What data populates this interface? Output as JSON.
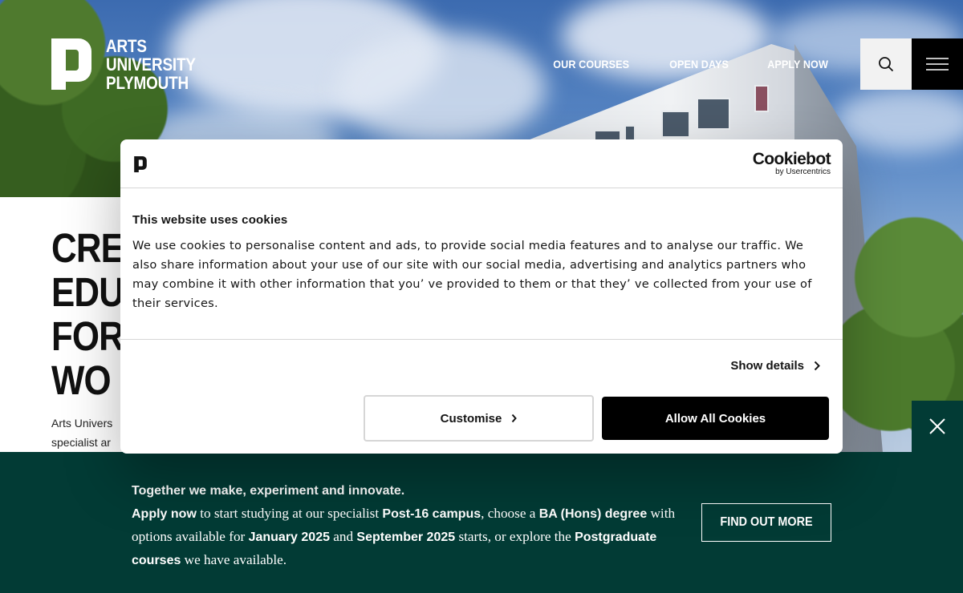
{
  "header": {
    "logo_lines": [
      "ARTS",
      "UNIVERSITY",
      "PLYMOUTH"
    ],
    "nav": [
      {
        "label": "OUR COURSES"
      },
      {
        "label": "OPEN DAYS"
      },
      {
        "label": "APPLY NOW"
      }
    ],
    "search_icon": "search-icon",
    "menu_icon": "hamburger-menu-icon"
  },
  "hero": {
    "title_lines": [
      "CRE",
      "EDU",
      "FOR",
      "WO"
    ],
    "intro_lines": [
      "Arts Univers",
      "specialist ar"
    ]
  },
  "cookie_dialog": {
    "brand": "Cookiebot",
    "brand_sub": "by Usercentrics",
    "title": "This website uses cookies",
    "text": "We use cookies to personalise content and ads, to provide social media features and to analyse our traffic. We also share information about your use of our site with our social media, advertising and analytics partners who may combine it with other information that you’ ve provided to them or that they’ ve collected from your use of their services.",
    "show_details": "Show details",
    "customise": "Customise",
    "allow_all": "Allow All Cookies"
  },
  "banner": {
    "line1": "Together we make, experiment and innovate.",
    "apply_now": "Apply now",
    "t1": " to start studying at our specialist ",
    "post16": "Post-16 campus",
    "t2": ", choose a ",
    "ba": "BA (Hons) degree",
    "t3": " with options available for ",
    "jan": "January 2025",
    "t4": " and ",
    "sep": "September 2025",
    "t5": " starts, or explore the ",
    "pg": "Postgraduate courses",
    "t6": " we have available.",
    "cta": "FIND OUT MORE",
    "close_icon": "close-icon"
  },
  "colors": {
    "banner_bg": "#023b35",
    "dialog_button": "#000000",
    "header_menu_bg": "#000000"
  }
}
